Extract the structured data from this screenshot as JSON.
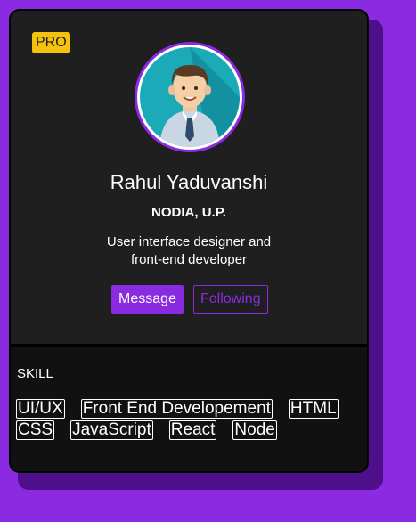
{
  "badge": "PRO",
  "profile": {
    "name": "Rahul Yaduvanshi",
    "location": "NODIA, U.P.",
    "bio": "User interface designer and front-end developer"
  },
  "actions": {
    "message": "Message",
    "following": "Following"
  },
  "skills": {
    "title": "SKILL",
    "rows": [
      [
        "UI/UX",
        "Front End Developement",
        "HTML"
      ],
      [
        "CSS",
        "JavaScript",
        "React",
        "Node"
      ]
    ]
  },
  "colors": {
    "background": "#8a2be2",
    "card": "#1f1f1f",
    "accent": "#8a2be2",
    "badge": "#f4c20d"
  },
  "icons": {
    "avatar": "male-user-avatar-icon"
  }
}
